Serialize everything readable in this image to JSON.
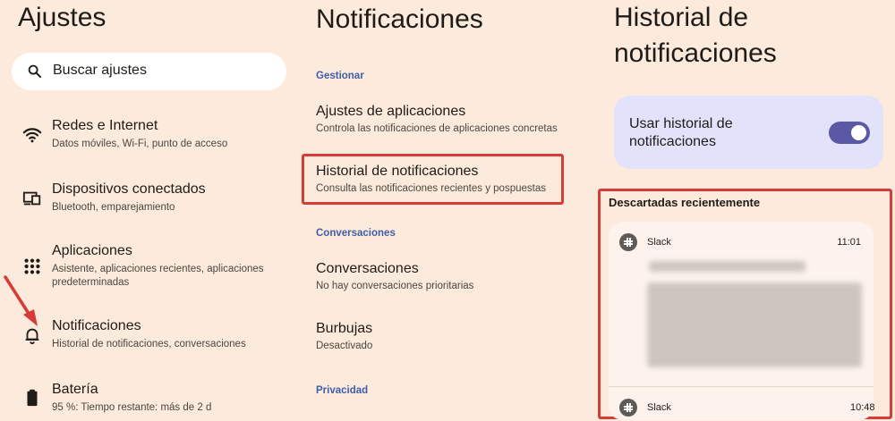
{
  "ajustes": {
    "title": "Ajustes",
    "search_placeholder": "Buscar ajustes",
    "items": [
      {
        "icon": "wifi-icon",
        "title": "Redes e Internet",
        "subtitle": "Datos móviles, Wi-Fi, punto de acceso"
      },
      {
        "icon": "devices-icon",
        "title": "Dispositivos conectados",
        "subtitle": "Bluetooth, emparejamiento"
      },
      {
        "icon": "apps-grid-icon",
        "title": "Aplicaciones",
        "subtitle": "Asistente, aplicaciones recientes, aplicaciones predeterminadas"
      },
      {
        "icon": "bell-icon",
        "title": "Notificaciones",
        "subtitle": "Historial de notificaciones, conversaciones"
      },
      {
        "icon": "battery-icon",
        "title": "Batería",
        "subtitle": "95 %: Tiempo restante: más de 2 d"
      }
    ]
  },
  "notificaciones": {
    "title": "Notificaciones",
    "section_gestionar": "Gestionar",
    "app_settings": {
      "title": "Ajustes de aplicaciones",
      "subtitle": "Controla las notificaciones de aplicaciones concretas"
    },
    "history": {
      "title": "Historial de notificaciones",
      "subtitle": "Consulta las notificaciones recientes y pospuestas"
    },
    "section_conversaciones": "Conversaciones",
    "conversations": {
      "title": "Conversaciones",
      "subtitle": "No hay conversaciones prioritarias"
    },
    "bubbles": {
      "title": "Burbujas",
      "subtitle": "Desactivado"
    },
    "section_privacidad": "Privacidad"
  },
  "historial": {
    "title_line1": "Historial de",
    "title_line2": "notificaciones",
    "toggle_label": "Usar historial de notificaciones",
    "toggle_on": true,
    "recent_title": "Descartadas recientemente",
    "notifications": [
      {
        "app": "Slack",
        "time": "11:01"
      },
      {
        "app": "Slack",
        "time": "10:48"
      }
    ]
  },
  "colors": {
    "background": "#fcebdc",
    "highlight": "#d73c38",
    "accent": "#5b59a5",
    "section_header": "#3f5da8"
  }
}
